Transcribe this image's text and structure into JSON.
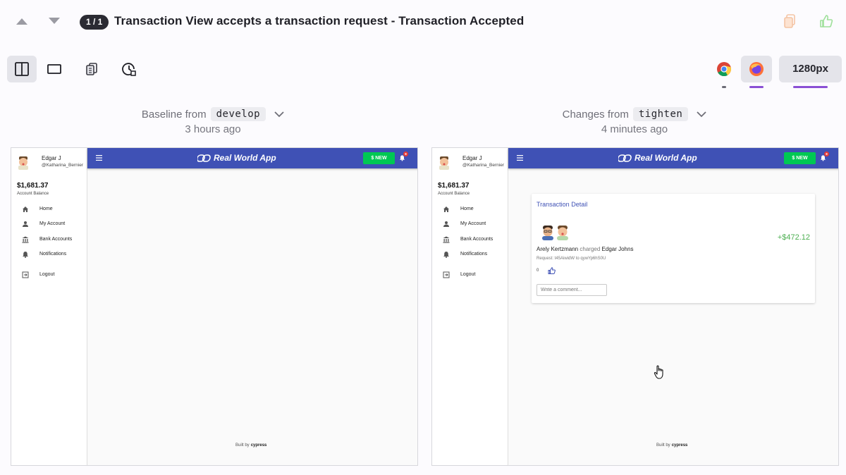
{
  "header": {
    "counter": "1 / 1",
    "title": "Transaction View accepts a transaction request - Transaction Accepted"
  },
  "toolbar": {
    "viewport": "1280px",
    "browsers": [
      "chrome",
      "firefox"
    ],
    "active_browser": "firefox",
    "colors": {
      "accent_underline": "#8a4fd4",
      "counter_bg": "#2b2b33"
    }
  },
  "baseline": {
    "label": "Baseline from",
    "branch": "develop",
    "time": "3 hours ago"
  },
  "changes": {
    "label": "Changes from",
    "branch": "tighten",
    "time": "4 minutes ago"
  },
  "app": {
    "user_name": "Edgar J",
    "user_handle": "@Katharina_Bernier",
    "balance": "$1,681.37",
    "balance_label": "Account Balance",
    "nav": [
      {
        "label": "Home",
        "icon": "home-icon"
      },
      {
        "label": "My Account",
        "icon": "person-icon"
      },
      {
        "label": "Bank Accounts",
        "icon": "bank-icon"
      },
      {
        "label": "Notifications",
        "icon": "bell-icon"
      },
      {
        "label": "Logout",
        "icon": "logout-icon"
      }
    ],
    "logo_text": "Real World App",
    "new_button": "$ NEW",
    "notification_count": "8",
    "footer_prefix": "Built by",
    "footer_brand": "cypress",
    "colors": {
      "appbar": "#3f51b5",
      "new_button": "#00c853",
      "amount": "#4caf50"
    }
  },
  "transaction": {
    "card_title": "Transaction Detail",
    "sender": "Arely Kertzmann",
    "action": "charged",
    "receiver": "Edgar Johns",
    "amount": "+$472.12",
    "request_note": "Request: t45AiwidW to qywYp6hS0U",
    "likes": "0",
    "comment_placeholder": "Write a comment..."
  }
}
